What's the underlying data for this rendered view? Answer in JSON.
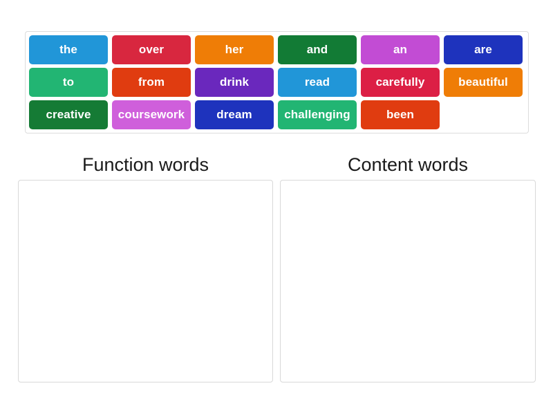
{
  "activity": {
    "type": "group-sort",
    "word_bank": {
      "rows": [
        [
          {
            "label": "the",
            "color": "#2196d8"
          },
          {
            "label": "over",
            "color": "#d8273f"
          },
          {
            "label": "her",
            "color": "#ef7d06"
          },
          {
            "label": "and",
            "color": "#127b35"
          },
          {
            "label": "an",
            "color": "#c24cd4"
          },
          {
            "label": "are",
            "color": "#1e33bd"
          }
        ],
        [
          {
            "label": "to",
            "color": "#22b573"
          },
          {
            "label": "from",
            "color": "#e03c10"
          },
          {
            "label": "drink",
            "color": "#6a28bd"
          },
          {
            "label": "read",
            "color": "#2196d8"
          },
          {
            "label": "carefully",
            "color": "#dc1f45"
          },
          {
            "label": "beautiful",
            "color": "#ef7d06"
          }
        ],
        [
          {
            "label": "creative",
            "color": "#157b35"
          },
          {
            "label": "coursework",
            "color": "#cf5fdb"
          },
          {
            "label": "dream",
            "color": "#1e33bd"
          },
          {
            "label": "challenging",
            "color": "#22b573"
          },
          {
            "label": "been",
            "color": "#e03c10"
          },
          {
            "label": "",
            "color": ""
          }
        ]
      ]
    },
    "categories": [
      {
        "heading": "Function words",
        "items": []
      },
      {
        "heading": "Content words",
        "items": []
      }
    ]
  }
}
